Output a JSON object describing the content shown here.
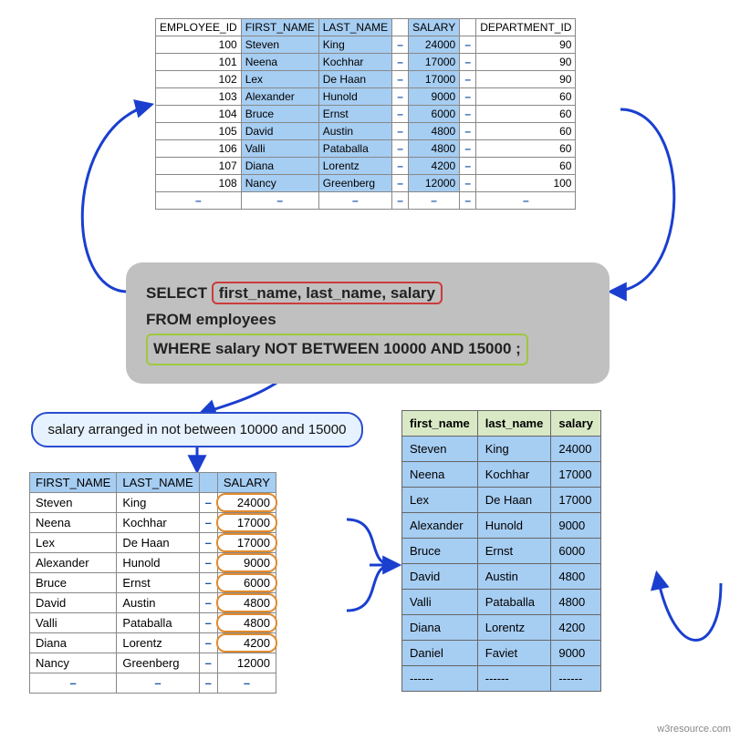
{
  "top_table": {
    "headers": [
      "EMPLOYEE_ID",
      "FIRST_NAME",
      "LAST_NAME",
      "",
      "SALARY",
      "",
      "DEPARTMENT_ID"
    ],
    "rows": [
      {
        "id": "100",
        "first": "Steven",
        "last": "King",
        "salary": "24000",
        "dept": "90"
      },
      {
        "id": "101",
        "first": "Neena",
        "last": "Kochhar",
        "salary": "17000",
        "dept": "90"
      },
      {
        "id": "102",
        "first": "Lex",
        "last": "De Haan",
        "salary": "17000",
        "dept": "90"
      },
      {
        "id": "103",
        "first": "Alexander",
        "last": "Hunold",
        "salary": "9000",
        "dept": "60"
      },
      {
        "id": "104",
        "first": "Bruce",
        "last": "Ernst",
        "salary": "6000",
        "dept": "60"
      },
      {
        "id": "105",
        "first": "David",
        "last": "Austin",
        "salary": "4800",
        "dept": "60"
      },
      {
        "id": "106",
        "first": "Valli",
        "last": "Pataballa",
        "salary": "4800",
        "dept": "60"
      },
      {
        "id": "107",
        "first": "Diana",
        "last": "Lorentz",
        "salary": "4200",
        "dept": "60"
      },
      {
        "id": "108",
        "first": "Nancy",
        "last": "Greenberg",
        "salary": "12000",
        "dept": "100"
      }
    ],
    "dash": "–"
  },
  "sql": {
    "select": "SELECT",
    "cols": "first_name, last_name, salary",
    "from": "FROM employees",
    "where": "WHERE salary NOT BETWEEN 10000 AND 15000 ;"
  },
  "bubble_text": "salary arranged in not between 10000 and 15000",
  "left_table": {
    "headers": [
      "FIRST_NAME",
      "LAST_NAME",
      "",
      "SALARY"
    ],
    "rows": [
      {
        "first": "Steven",
        "last": "King",
        "salary": "24000",
        "c": true
      },
      {
        "first": "Neena",
        "last": "Kochhar",
        "salary": "17000",
        "c": true
      },
      {
        "first": "Lex",
        "last": "De Haan",
        "salary": "17000",
        "c": true
      },
      {
        "first": "Alexander",
        "last": "Hunold",
        "salary": "9000",
        "c": true
      },
      {
        "first": "Bruce",
        "last": "Ernst",
        "salary": "6000",
        "c": true
      },
      {
        "first": "David",
        "last": "Austin",
        "salary": "4800",
        "c": true
      },
      {
        "first": "Valli",
        "last": "Pataballa",
        "salary": "4800",
        "c": true
      },
      {
        "first": "Diana",
        "last": "Lorentz",
        "salary": "4200",
        "c": true
      },
      {
        "first": "Nancy",
        "last": "Greenberg",
        "salary": "12000",
        "c": false
      }
    ],
    "dash": "–"
  },
  "right_table": {
    "headers": [
      "first_name",
      "last_name",
      "salary"
    ],
    "rows": [
      {
        "first": "Steven",
        "last": "King",
        "salary": "24000"
      },
      {
        "first": "Neena",
        "last": "Kochhar",
        "salary": "17000"
      },
      {
        "first": "Lex",
        "last": "De Haan",
        "salary": "17000"
      },
      {
        "first": "Alexander",
        "last": "Hunold",
        "salary": "9000"
      },
      {
        "first": "Bruce",
        "last": "Ernst",
        "salary": "6000"
      },
      {
        "first": "David",
        "last": "Austin",
        "salary": "4800"
      },
      {
        "first": "Valli",
        "last": "Pataballa",
        "salary": "4800"
      },
      {
        "first": "Diana",
        "last": "Lorentz",
        "salary": "4200"
      },
      {
        "first": "Daniel",
        "last": "Faviet",
        "salary": "9000"
      },
      {
        "first": "------",
        "last": "------",
        "salary": "------"
      }
    ]
  },
  "watermark": "w3resource.com"
}
